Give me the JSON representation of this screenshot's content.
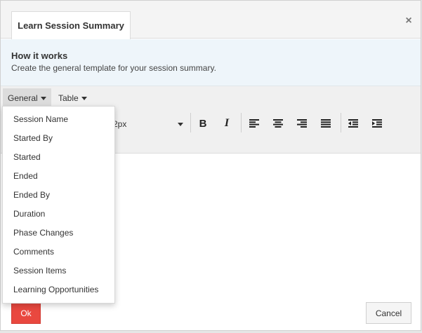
{
  "dialog": {
    "tab_title": "Learn Session Summary",
    "close_symbol": "×"
  },
  "info": {
    "title": "How it works",
    "text": "Create the general template for your session summary."
  },
  "menubar": {
    "general_label": "General",
    "table_label": "Table"
  },
  "toolbar": {
    "font_size_value": "12px",
    "font_size_visible": "2px",
    "icons": [
      "bold-icon",
      "italic-icon",
      "align-left-icon",
      "align-center-icon",
      "align-right-icon",
      "align-justify-icon",
      "outdent-icon",
      "indent-icon"
    ]
  },
  "general_menu": {
    "items": [
      {
        "label": "Session Name"
      },
      {
        "label": "Started By"
      },
      {
        "label": "Started"
      },
      {
        "label": "Ended"
      },
      {
        "label": "Ended By"
      },
      {
        "label": "Duration"
      },
      {
        "label": "Phase Changes"
      },
      {
        "label": "Comments"
      },
      {
        "label": "Session Items"
      },
      {
        "label": "Learning Opportunities"
      }
    ]
  },
  "footer": {
    "ok_label": "Ok",
    "cancel_label": "Cancel"
  },
  "colors": {
    "ok_button": "#e9483f",
    "info_background": "#eef5fa",
    "toolbar_background": "#f0f0f0"
  }
}
